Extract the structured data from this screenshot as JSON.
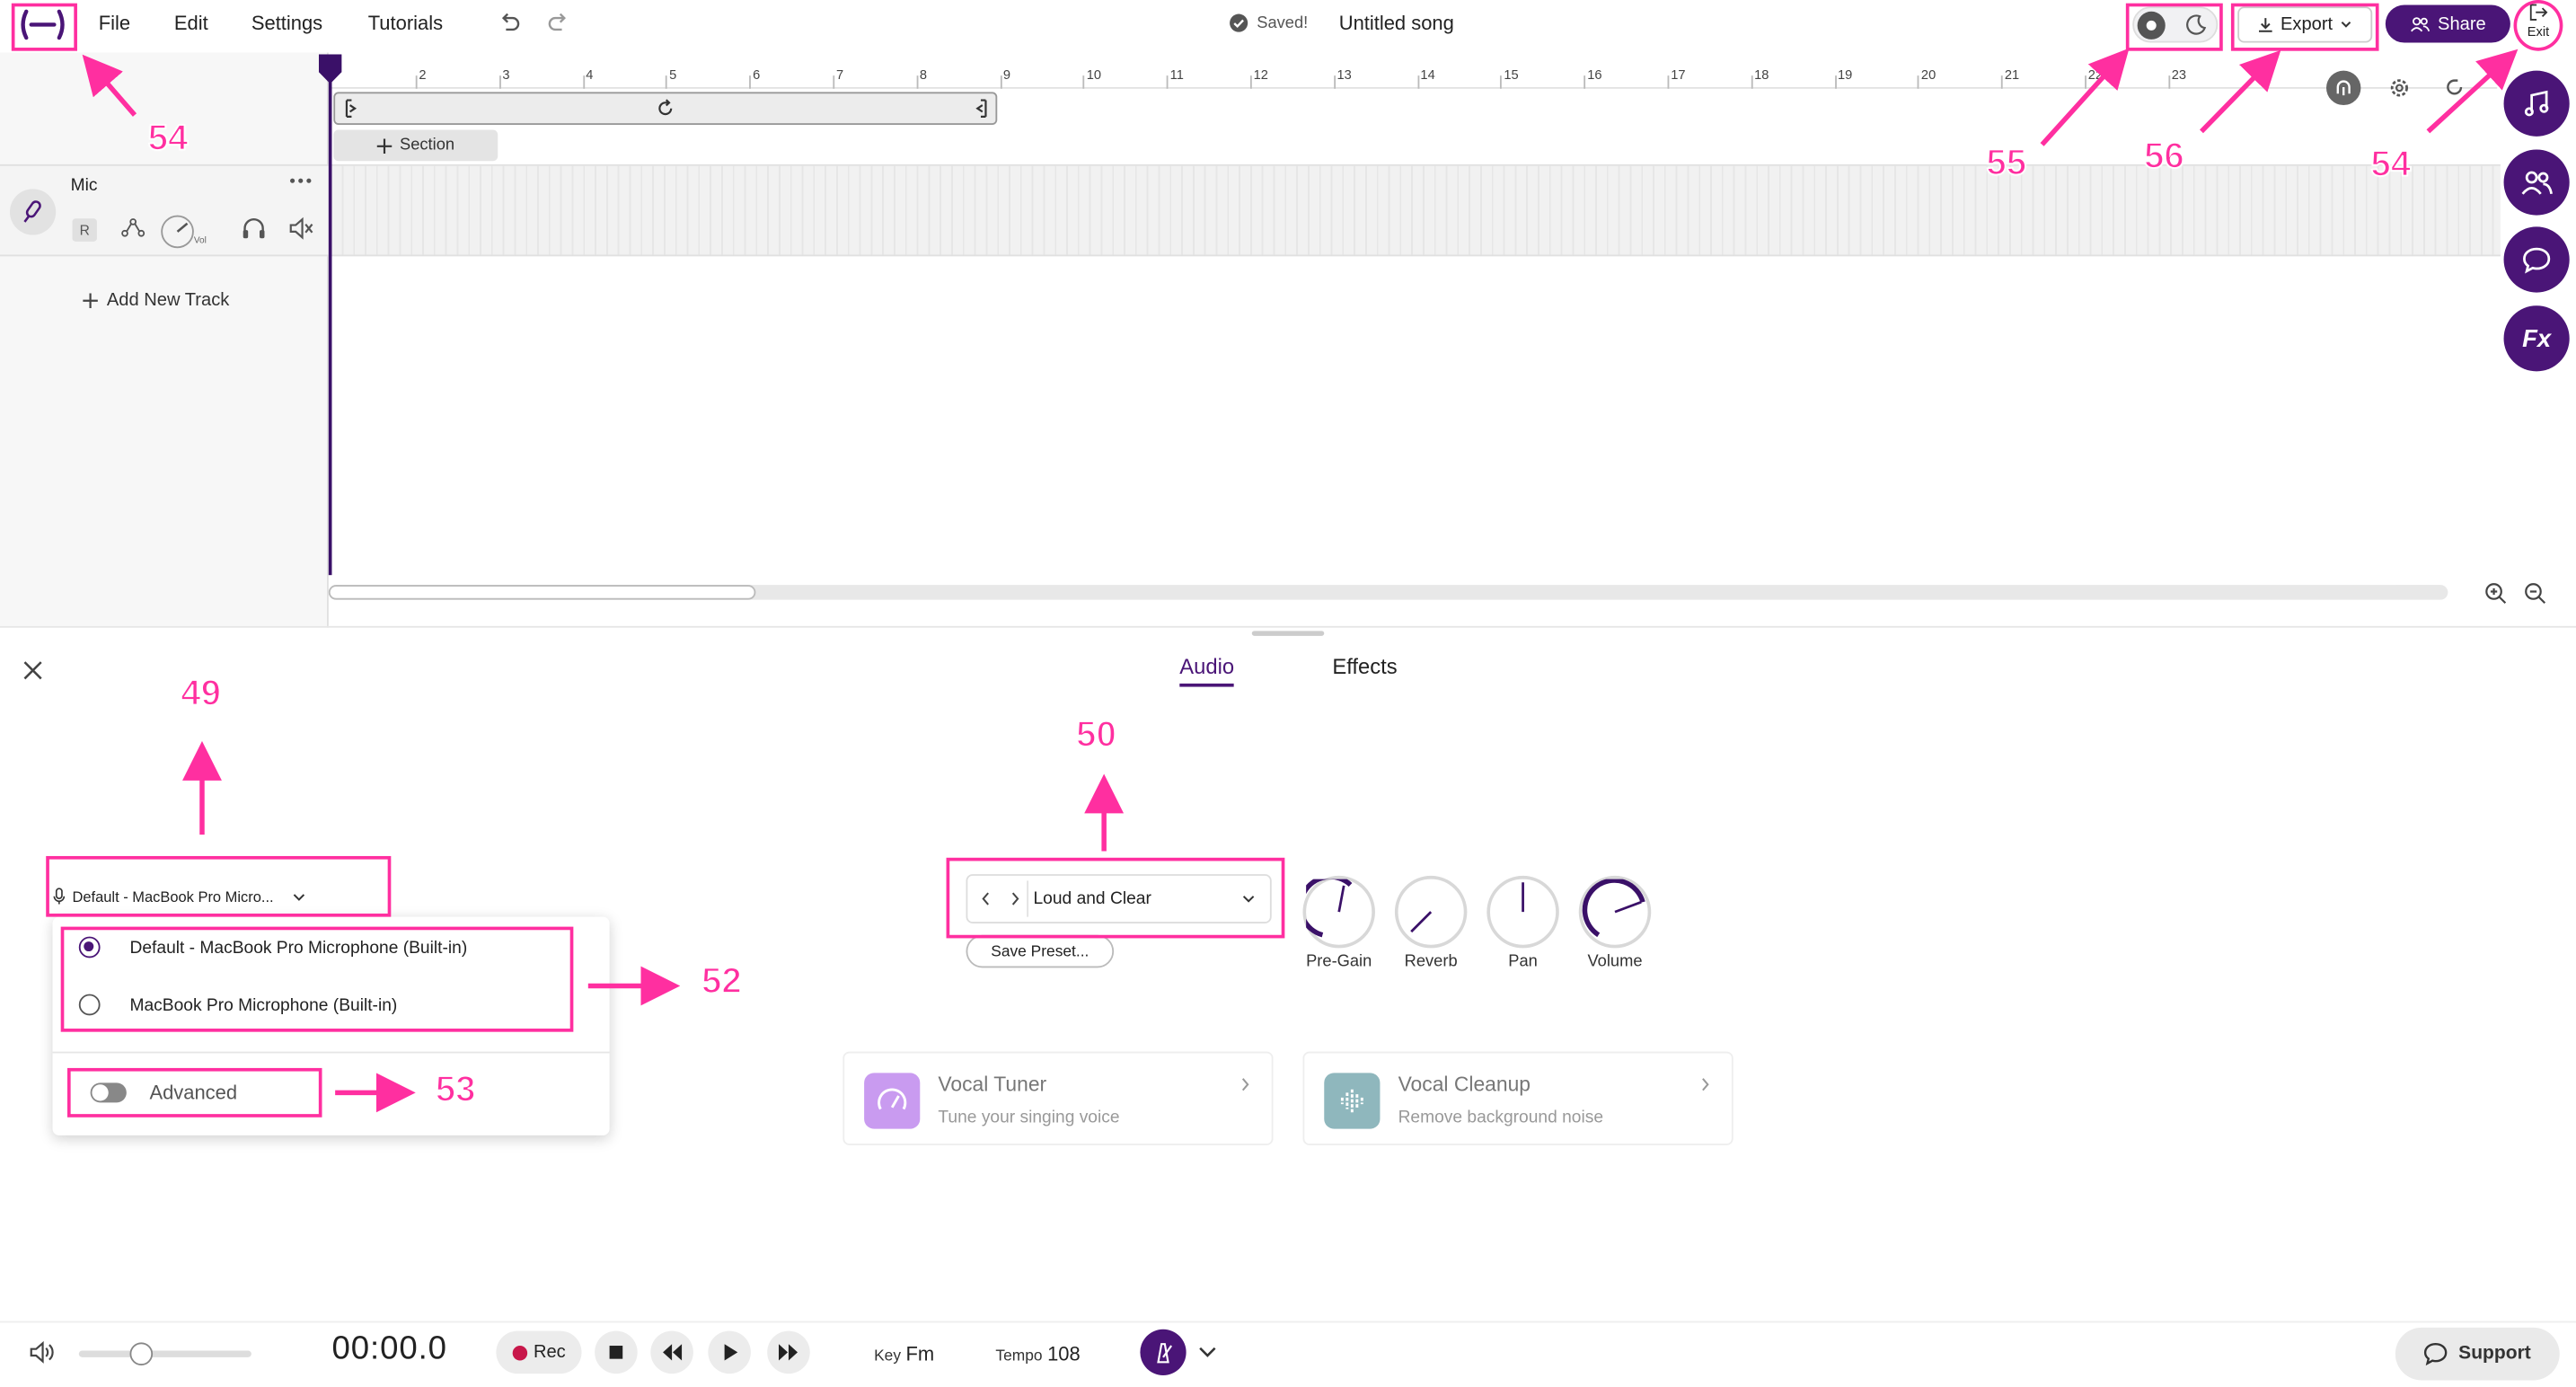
{
  "menu": {
    "file": "File",
    "edit": "Edit",
    "settings": "Settings",
    "tutorials": "Tutorials"
  },
  "status": {
    "saved": "Saved!",
    "song_title": "Untitled song"
  },
  "header": {
    "export_label": "Export",
    "share_label": "Share",
    "exit_label": "Exit"
  },
  "timeline": {
    "ruler_numbers": [
      "2",
      "3",
      "4",
      "5",
      "6",
      "7",
      "8",
      "9",
      "10",
      "11",
      "12",
      "13",
      "14",
      "15",
      "16",
      "17",
      "18",
      "19",
      "20",
      "21",
      "22",
      "23"
    ],
    "section_label": "Section"
  },
  "track": {
    "name": "Mic",
    "record_label": "R",
    "vol_label": "Vol"
  },
  "add_track_label": "Add New Track",
  "panel": {
    "tab_audio": "Audio",
    "tab_effects": "Effects",
    "mic_selected": "Default - MacBook Pro Micro...",
    "mic_options": [
      "Default - MacBook Pro Microphone (Built-in)",
      "MacBook Pro Microphone (Built-in)"
    ],
    "advanced_label": "Advanced",
    "preset_name": "Loud and Clear",
    "save_preset": "Save Preset...",
    "knobs": [
      "Pre-Gain",
      "Reverb",
      "Pan",
      "Volume"
    ],
    "features": [
      {
        "title": "Vocal Tuner",
        "subtitle": "Tune your singing voice"
      },
      {
        "title": "Vocal Cleanup",
        "subtitle": "Remove background noise"
      }
    ]
  },
  "transport": {
    "time": "00:00.0",
    "rec_label": "Rec",
    "key_label": "Key",
    "key_value": "Fm",
    "tempo_label": "Tempo",
    "tempo_value": "108",
    "support_label": "Support",
    "volume_fraction": 0.36
  },
  "annotations": [
    "54",
    "55",
    "56",
    "54",
    "49",
    "50",
    "52",
    "53"
  ],
  "colors": {
    "accent": "#4a1577",
    "annotation": "#ff2fa0",
    "rec": "#c8174a"
  }
}
